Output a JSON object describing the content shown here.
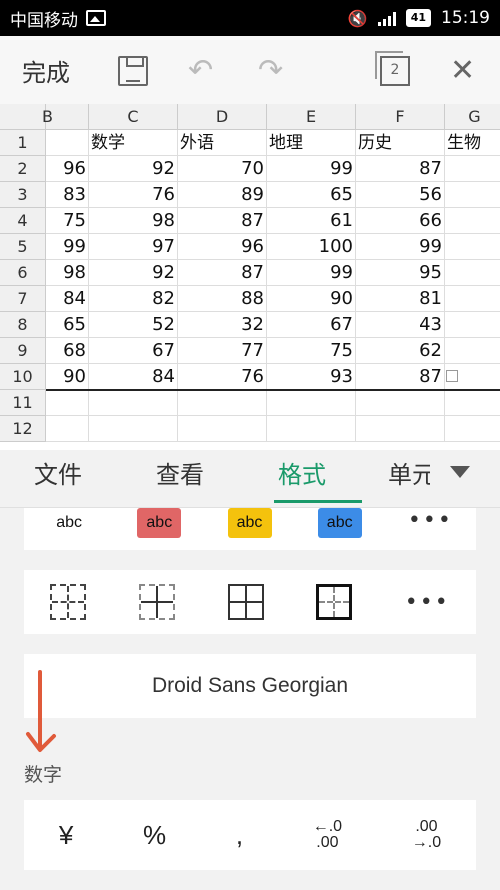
{
  "status_bar": {
    "carrier": "中国移动",
    "battery": "41",
    "time": "15:19"
  },
  "toolbar": {
    "done_label": "完成",
    "window_count": "2"
  },
  "sheet": {
    "columns": [
      "B",
      "C",
      "D",
      "E",
      "F",
      "G"
    ],
    "row_numbers": [
      "1",
      "2",
      "3",
      "4",
      "5",
      "6",
      "7",
      "8",
      "9",
      "10",
      "11",
      "12"
    ],
    "header_row": [
      "",
      "数学",
      "外语",
      "地理",
      "历史",
      "生物"
    ],
    "rows": [
      [
        "96",
        "92",
        "70",
        "99",
        "87",
        ""
      ],
      [
        "83",
        "76",
        "89",
        "65",
        "56",
        ""
      ],
      [
        "75",
        "98",
        "87",
        "61",
        "66",
        ""
      ],
      [
        "99",
        "97",
        "96",
        "100",
        "99",
        ""
      ],
      [
        "98",
        "92",
        "87",
        "99",
        "95",
        ""
      ],
      [
        "84",
        "82",
        "88",
        "90",
        "81",
        ""
      ],
      [
        "65",
        "52",
        "32",
        "67",
        "43",
        ""
      ],
      [
        "68",
        "67",
        "77",
        "75",
        "62",
        ""
      ],
      [
        "90",
        "84",
        "76",
        "93",
        "87",
        ""
      ]
    ]
  },
  "tabs": [
    {
      "label": "文件"
    },
    {
      "label": "查看"
    },
    {
      "label": "格式",
      "active": true
    },
    {
      "label": "单元"
    }
  ],
  "text_styles": [
    {
      "label": "abc",
      "bg": "#ffffff",
      "color": "#111111"
    },
    {
      "label": "abc",
      "bg": "#e06666",
      "color": "#111111"
    },
    {
      "label": "abc",
      "bg": "#f4c20d",
      "color": "#111111"
    },
    {
      "label": "abc",
      "bg": "#3c8ce7",
      "color": "#111111"
    }
  ],
  "more_label": "•••",
  "font_name": "Droid Sans Georgian",
  "number_section": {
    "label": "数字",
    "items": [
      "¥",
      "%",
      ",",
      "←.0\n.00",
      ".00\n→.0"
    ]
  },
  "colors": {
    "accent": "#1a9a6a",
    "arrow": "#e05a3a"
  }
}
